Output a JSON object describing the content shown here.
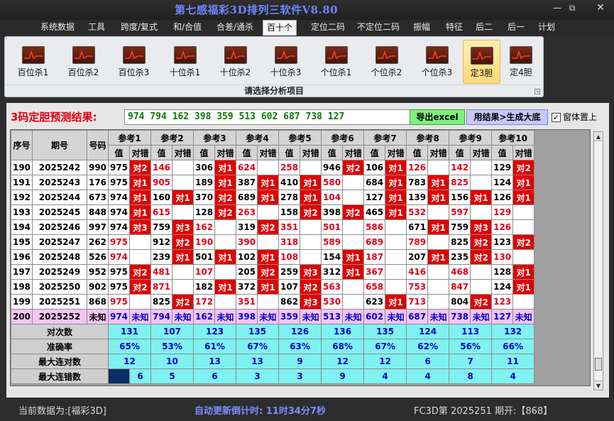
{
  "app": {
    "title": "第七感福彩3D排列三软件V8.80"
  },
  "window": {
    "minimize_icon": "minimize-icon",
    "restore_icon": "restore-icon",
    "close_icon": "close-icon"
  },
  "menu": [
    "系统数据",
    "工具",
    "跨度/复式",
    "和/合值",
    "合差/通杀",
    "百十个",
    "定位二码",
    "不定位二码",
    "振幅",
    "特征",
    "后二",
    "后一",
    "计划"
  ],
  "menu_active": "百十个",
  "ribbon": {
    "buttons": [
      "百位杀1",
      "百位杀2",
      "百位杀3",
      "十位杀1",
      "十位杀2",
      "十位杀3",
      "个位杀1",
      "个位杀2",
      "个位杀3",
      "定3胆",
      "定4胆"
    ],
    "active": "定3胆",
    "caption": "请选择分析项目"
  },
  "prediction": {
    "label": "3码定胆预测结果:",
    "value": "974 794 162 398 359 513 602 687 738 127",
    "export_label": "导出excel",
    "gen_label": "用结果>生成大底",
    "ontop_label": "窗体置上",
    "ontop_checked": true
  },
  "table": {
    "header": {
      "seq": "序号",
      "period": "期号",
      "code": "号码",
      "value": "值",
      "check": "对错"
    },
    "ref_names": [
      "参考1",
      "参考2",
      "参考3",
      "参考4",
      "参考5",
      "参考6",
      "参考7",
      "参考8",
      "参考9",
      "参考10"
    ],
    "rows": [
      {
        "seq": "190",
        "period": "2025242",
        "code": "990",
        "refs": [
          [
            "975",
            "对2"
          ],
          [
            "146",
            ""
          ],
          [
            "306",
            "对1"
          ],
          [
            "624",
            ""
          ],
          [
            "258",
            ""
          ],
          [
            "946",
            "对2"
          ],
          [
            "106",
            "对1"
          ],
          [
            "126",
            ""
          ],
          [
            "142",
            ""
          ],
          [
            "129",
            "对2"
          ]
        ]
      },
      {
        "seq": "191",
        "period": "2025243",
        "code": "176",
        "refs": [
          [
            "975",
            "对1"
          ],
          [
            "905",
            ""
          ],
          [
            "189",
            "对1"
          ],
          [
            "387",
            "对1"
          ],
          [
            "410",
            "对1"
          ],
          [
            "580",
            ""
          ],
          [
            "684",
            "对1"
          ],
          [
            "783",
            "对1"
          ],
          [
            "825",
            ""
          ],
          [
            "124",
            "对1"
          ]
        ]
      },
      {
        "seq": "192",
        "period": "2025244",
        "code": "673",
        "refs": [
          [
            "974",
            "对1"
          ],
          [
            "160",
            "对1"
          ],
          [
            "370",
            "对2"
          ],
          [
            "689",
            "对1"
          ],
          [
            "278",
            "对1"
          ],
          [
            "104",
            ""
          ],
          [
            "127",
            "对1"
          ],
          [
            "139",
            "对1"
          ],
          [
            "156",
            "对1"
          ],
          [
            "126",
            "对1"
          ]
        ]
      },
      {
        "seq": "193",
        "period": "2025245",
        "code": "848",
        "refs": [
          [
            "974",
            "对1"
          ],
          [
            "615",
            ""
          ],
          [
            "128",
            "对2"
          ],
          [
            "263",
            ""
          ],
          [
            "158",
            "对2"
          ],
          [
            "398",
            "对2"
          ],
          [
            "465",
            "对1"
          ],
          [
            "532",
            ""
          ],
          [
            "597",
            ""
          ],
          [
            "129",
            ""
          ]
        ]
      },
      {
        "seq": "194",
        "period": "2025246",
        "code": "997",
        "refs": [
          [
            "974",
            "对3"
          ],
          [
            "759",
            "对3"
          ],
          [
            "162",
            ""
          ],
          [
            "319",
            "对2"
          ],
          [
            "351",
            ""
          ],
          [
            "501",
            ""
          ],
          [
            "586",
            ""
          ],
          [
            "671",
            "对1"
          ],
          [
            "759",
            "对3"
          ],
          [
            "126",
            ""
          ]
        ]
      },
      {
        "seq": "195",
        "period": "2025247",
        "code": "262",
        "refs": [
          [
            "975",
            ""
          ],
          [
            "912",
            "对2"
          ],
          [
            "190",
            ""
          ],
          [
            "390",
            ""
          ],
          [
            "318",
            ""
          ],
          [
            "589",
            ""
          ],
          [
            "689",
            ""
          ],
          [
            "789",
            ""
          ],
          [
            "825",
            "对2"
          ],
          [
            "123",
            "对2"
          ]
        ]
      },
      {
        "seq": "196",
        "period": "2025248",
        "code": "526",
        "refs": [
          [
            "974",
            ""
          ],
          [
            "239",
            "对1"
          ],
          [
            "501",
            "对1"
          ],
          [
            "102",
            "对1"
          ],
          [
            "108",
            ""
          ],
          [
            "154",
            "对1"
          ],
          [
            "187",
            ""
          ],
          [
            "207",
            "对1"
          ],
          [
            "235",
            "对2"
          ],
          [
            "130",
            ""
          ]
        ]
      },
      {
        "seq": "197",
        "period": "2025249",
        "code": "952",
        "refs": [
          [
            "975",
            "对2"
          ],
          [
            "481",
            ""
          ],
          [
            "107",
            ""
          ],
          [
            "205",
            "对2"
          ],
          [
            "259",
            "对3"
          ],
          [
            "312",
            "对1"
          ],
          [
            "367",
            ""
          ],
          [
            "416",
            ""
          ],
          [
            "468",
            ""
          ],
          [
            "128",
            "对1"
          ]
        ]
      },
      {
        "seq": "198",
        "period": "2025250",
        "code": "902",
        "refs": [
          [
            "975",
            "对2"
          ],
          [
            "871",
            ""
          ],
          [
            "182",
            "对1"
          ],
          [
            "372",
            "对1"
          ],
          [
            "107",
            "对2"
          ],
          [
            "563",
            ""
          ],
          [
            "658",
            ""
          ],
          [
            "753",
            ""
          ],
          [
            "847",
            ""
          ],
          [
            "124",
            "对1"
          ]
        ]
      },
      {
        "seq": "199",
        "period": "2025251",
        "code": "868",
        "refs": [
          [
            "975",
            ""
          ],
          [
            "825",
            "对2"
          ],
          [
            "172",
            ""
          ],
          [
            "351",
            ""
          ],
          [
            "862",
            "对3"
          ],
          [
            "530",
            ""
          ],
          [
            "623",
            "对1"
          ],
          [
            "713",
            ""
          ],
          [
            "804",
            "对2"
          ],
          [
            "123",
            ""
          ]
        ]
      }
    ],
    "future": {
      "seq": "200",
      "period": "2025252",
      "code": "未知",
      "refs": [
        [
          "974",
          "未知"
        ],
        [
          "794",
          "未知"
        ],
        [
          "162",
          "未知"
        ],
        [
          "398",
          "未知"
        ],
        [
          "359",
          "未知"
        ],
        [
          "513",
          "未知"
        ],
        [
          "602",
          "未知"
        ],
        [
          "687",
          "未知"
        ],
        [
          "738",
          "未知"
        ],
        [
          "127",
          "未知"
        ]
      ]
    },
    "stats": [
      {
        "label": "对次数",
        "values": [
          "131",
          "107",
          "123",
          "135",
          "126",
          "136",
          "135",
          "124",
          "113",
          "132"
        ]
      },
      {
        "label": "准确率",
        "values": [
          "65%",
          "53%",
          "61%",
          "67%",
          "63%",
          "68%",
          "67%",
          "62%",
          "56%",
          "66%"
        ]
      },
      {
        "label": "最大连对数",
        "values": [
          "12",
          "10",
          "13",
          "13",
          "9",
          "12",
          "12",
          "6",
          "7",
          "11"
        ]
      },
      {
        "label": "最大连错数",
        "values": [
          "6",
          "5",
          "6",
          "3",
          "3",
          "9",
          "4",
          "4",
          "8",
          "4"
        ]
      }
    ]
  },
  "status": {
    "current": "当前数据为:[福彩3D]",
    "countdown": "自动更新倒计时: 11时34分7秒",
    "period": "FC3D第 2025251 期开:【868】"
  }
}
